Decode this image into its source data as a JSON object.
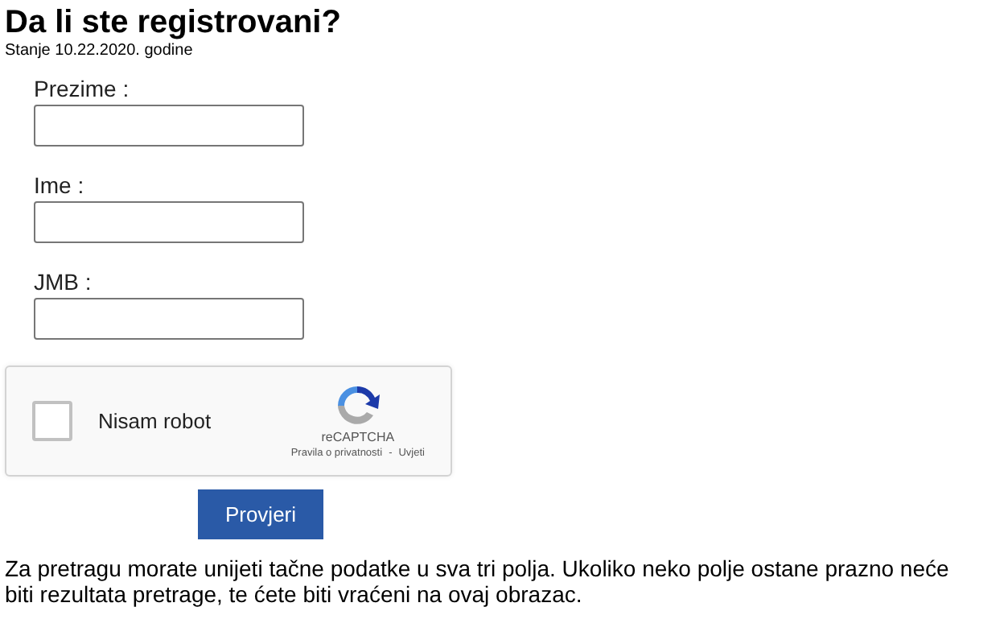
{
  "title": "Da li ste registrovani?",
  "subtitle": "Stanje 10.22.2020. godine",
  "fields": [
    {
      "label": "Prezime :"
    },
    {
      "label": "Ime :"
    },
    {
      "label": "JMB :"
    }
  ],
  "captcha": {
    "label": "Nisam robot",
    "checked": false,
    "brand": "reCAPTCHA",
    "links": [
      "Pravila o privatnosti",
      "Uvjeti"
    ],
    "separator": "-"
  },
  "button": "Provjeri",
  "note": "Za pretragu morate unijeti tačne podatke u sva tri polja. Ukoliko neko polje ostane prazno neće biti rezultata pretrage, te ćete biti vraćeni na ovaj obrazac."
}
